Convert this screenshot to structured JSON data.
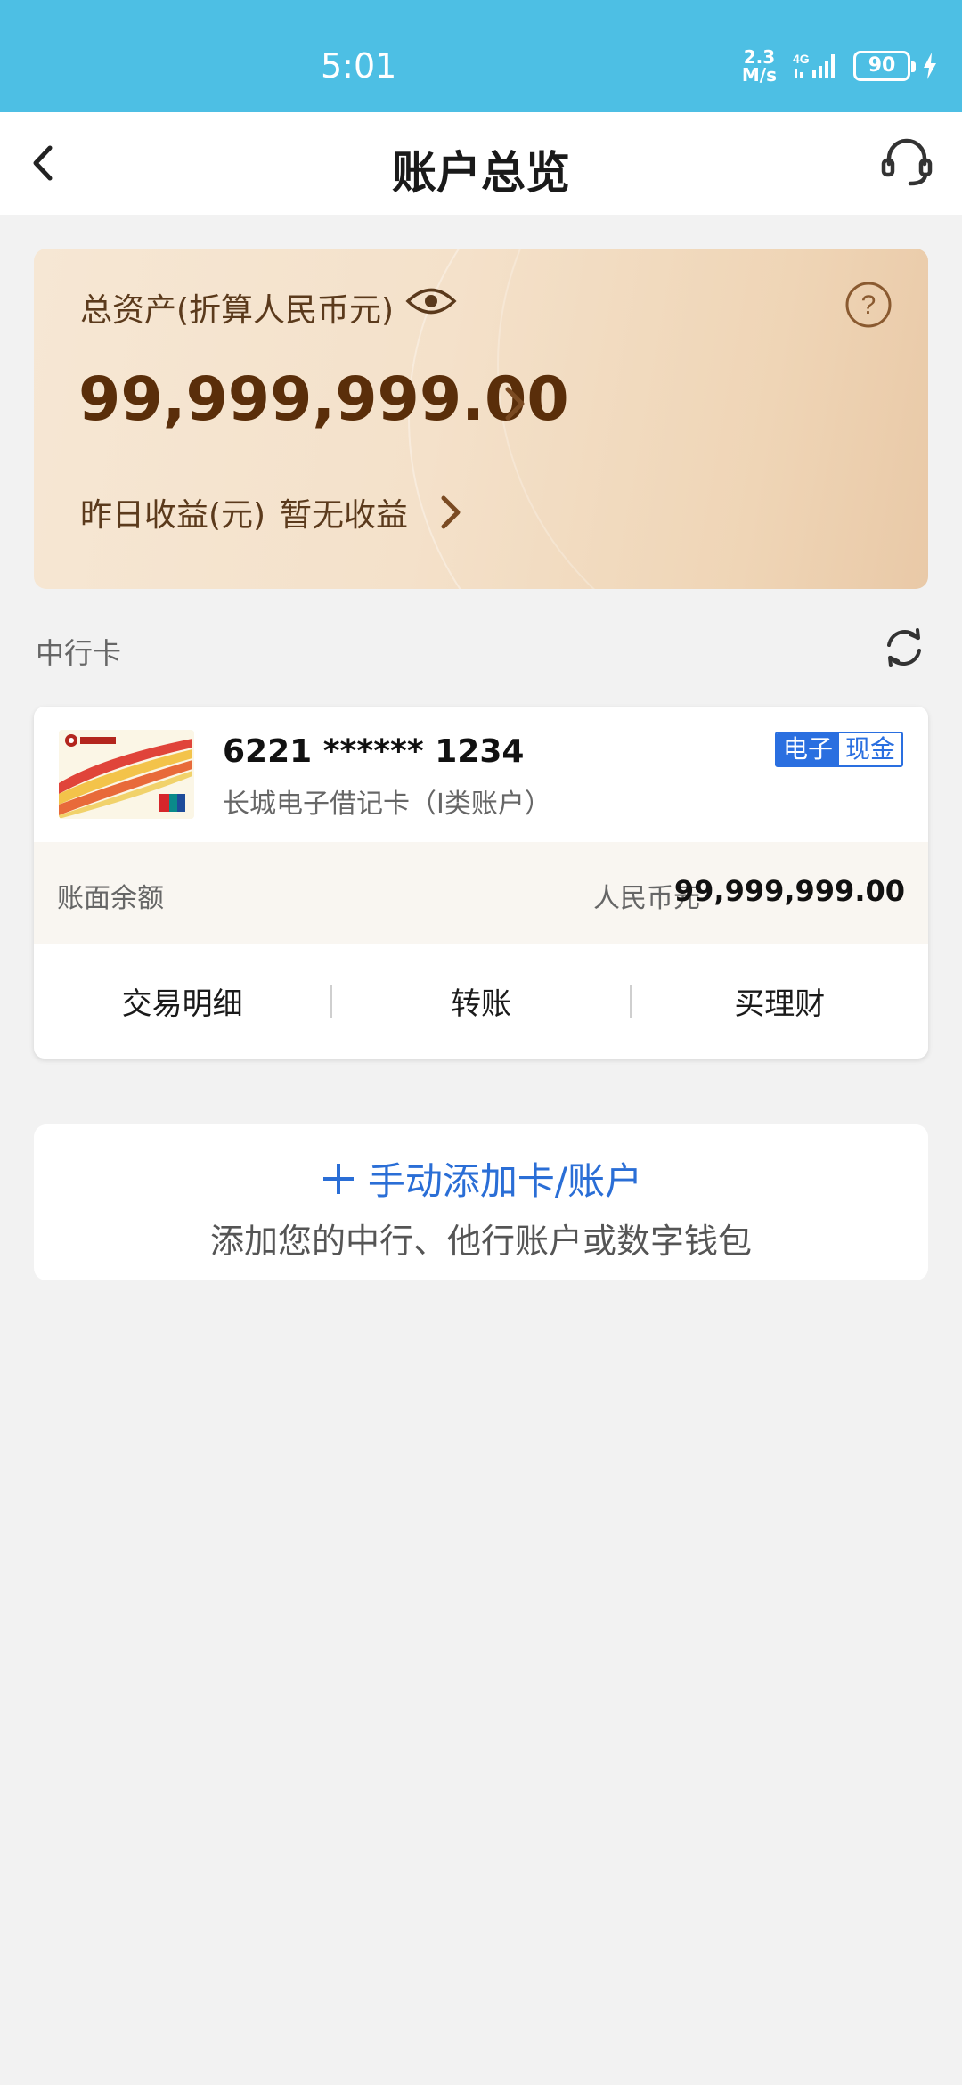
{
  "status_bar": {
    "time": "5:01",
    "net_speed_value": "2.3",
    "net_speed_unit": "M/s",
    "network": "4G",
    "battery": "90"
  },
  "header": {
    "title": "账户总览",
    "back_icon": "chevron-left-icon",
    "support_icon": "headset-icon"
  },
  "asset_card": {
    "label": "总资产(折算人民币元)",
    "amount": "99,999,999.00",
    "yesterday_label": "昨日收益(元)",
    "yesterday_value": "暂无收益",
    "icons": [
      "eye-icon",
      "help-icon",
      "chevron-right-icon"
    ]
  },
  "section": {
    "title": "中行卡",
    "refresh_icon": "refresh-icon"
  },
  "account": {
    "card_number": "6221 ****** 1234",
    "card_type": "长城电子借记卡（I类账户）",
    "badge_left": "电子",
    "badge_right": "现金",
    "balance_label": "账面余额",
    "currency": "人民币元",
    "balance": "99,999,999.00",
    "actions": [
      "交易明细",
      "转账",
      "买理财"
    ]
  },
  "add_card": {
    "title": "手动添加卡/账户",
    "subtitle": "添加您的中行、他行账户或数字钱包"
  },
  "colors": {
    "status_bar": "#4dbfe4",
    "accent_blue": "#2a6ed6",
    "asset_text": "#5a2e0a",
    "background": "#f2f2f2"
  }
}
